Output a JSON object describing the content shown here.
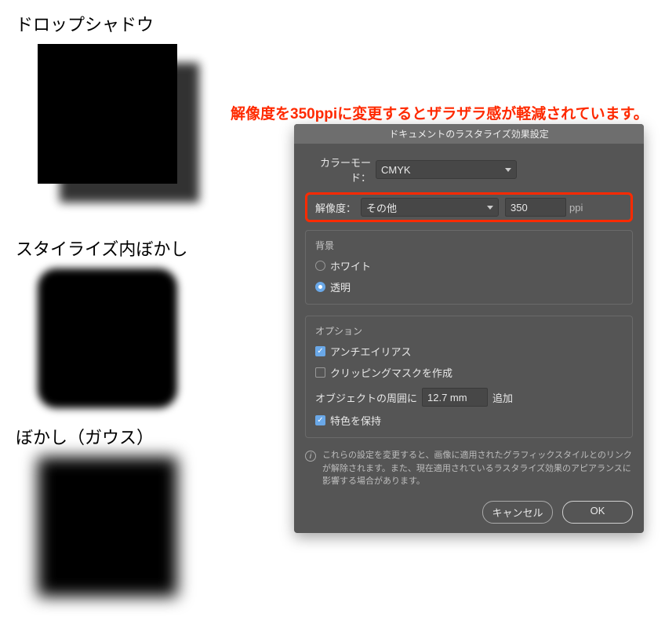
{
  "left": {
    "sample1_label": "ドロップシャドウ",
    "sample2_label": "スタイライズ内ぼかし",
    "sample3_label": "ぼかし（ガウス）"
  },
  "annotation": "解像度を350ppiに変更するとザラザラ感が軽減されています。",
  "dialog": {
    "title": "ドキュメントのラスタライズ効果設定",
    "color_mode_label": "カラーモード：",
    "color_mode_value": "CMYK",
    "resolution_label": "解像度：",
    "resolution_preset": "その他",
    "resolution_value": "350",
    "resolution_unit": "ppi",
    "background": {
      "group_label": "背景",
      "white": "ホワイト",
      "transparent": "透明",
      "selected": "transparent"
    },
    "options": {
      "group_label": "オプション",
      "antialias": "アンチエイリアス",
      "clipping": "クリッピングマスクを作成",
      "around_prefix": "オブジェクトの周囲に",
      "around_value": "12.7 mm",
      "around_suffix": "追加",
      "preserve_spot": "特色を保持",
      "antialias_checked": true,
      "clipping_checked": false,
      "preserve_spot_checked": true
    },
    "info": "これらの設定を変更すると、画像に適用されたグラフィックスタイルとのリンクが解除されます。また、現在適用されているラスタライズ効果のアピアランスに影響する場合があります。",
    "cancel": "キャンセル",
    "ok": "OK"
  }
}
